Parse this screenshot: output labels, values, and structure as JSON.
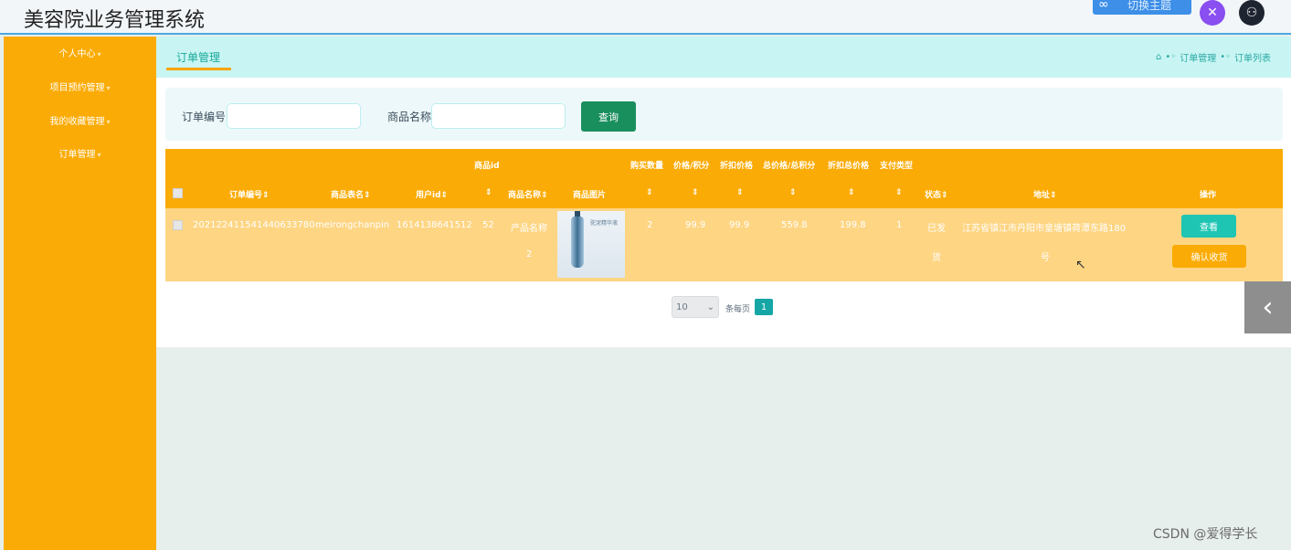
{
  "header": {
    "title": "美容院业务管理系统",
    "ctrl_icon": "link-icon",
    "ctrl_label": "切换主题",
    "icon_purple": "fullscreen-icon",
    "icon_dark": "user-icon"
  },
  "sidebar": {
    "items": [
      {
        "label": "个人中心"
      },
      {
        "label": "项目预约管理"
      },
      {
        "label": "我的收藏管理"
      },
      {
        "label": "订单管理"
      }
    ]
  },
  "tab": {
    "active": "订单管理"
  },
  "breadcrumb": {
    "items": [
      "订单管理",
      "订单列表"
    ]
  },
  "search": {
    "order_no_label": "订单编号",
    "order_no_value": "",
    "product_name_label": "商品名称",
    "product_name_value": "",
    "query_button": "查询"
  },
  "table": {
    "header_top": [
      "商品id",
      "购买数量",
      "价格/积分",
      "折扣价格",
      "总价格/总积分",
      "折扣总价格",
      "支付类型"
    ],
    "header_bottom": [
      "订单编号",
      "商品表名",
      "用户id",
      "商品名称",
      "商品图片",
      "状态",
      "地址",
      "操作"
    ],
    "rows": [
      {
        "order_no": "202122411541440633780",
        "table_name": "meirongchanpin",
        "user_id": "1614138641512",
        "goods_id": "52",
        "goods_name_1": "产品名称",
        "goods_name_2": "2",
        "image_caption": "驼泥精华液",
        "quantity": "2",
        "price": "99.9",
        "discount_price": "99.9",
        "total": "559.8",
        "discount_total": "199.8",
        "pay_type": "1",
        "status_1": "已发",
        "status_2": "货",
        "address_1": "江苏省镇江市丹阳市皇塘镇荷潭东路180",
        "address_2": "号",
        "view_button": "查看",
        "confirm_button": "确认收货"
      }
    ]
  },
  "pagination": {
    "page_size": "10",
    "per_page_label": "条每页",
    "current_page": "1"
  },
  "watermark": "CSDN @爱得学长"
}
